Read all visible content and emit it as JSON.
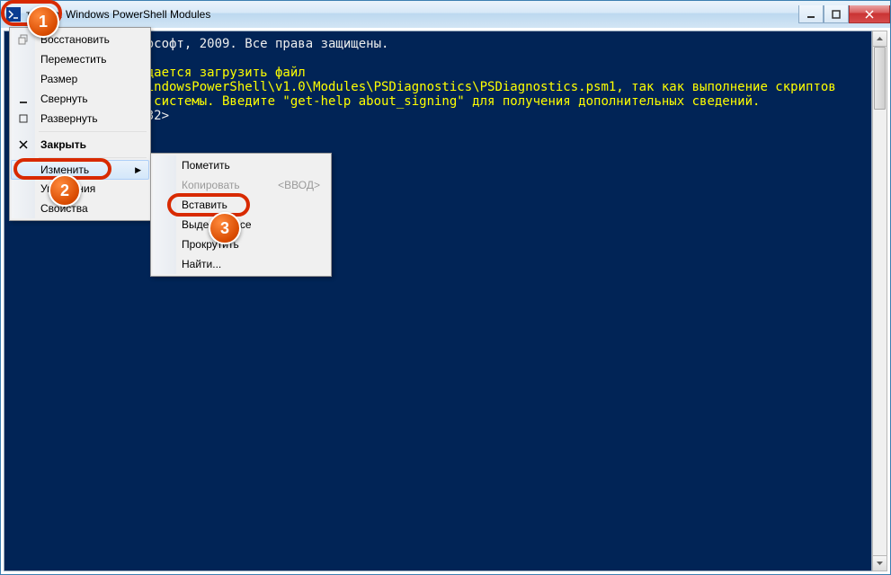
{
  "window": {
    "title": "тратор: Windows PowerShell Modules"
  },
  "console": {
    "line1_white": "ософт, 2009. Все права защищены.",
    "line2_y": "дается загрузить файл",
    "line3_y": "indowsPowerShell\\v1.0\\Modules\\PSDiagnostics\\PSDiagnostics.psm1, так как выполнение скриптов",
    "line4_y": " системы. Введите \"get-help about_signing\" для получения дополнительных сведений.",
    "line5_w": "32>"
  },
  "sysmenu": {
    "restore": "Восстановить",
    "move": "Переместить",
    "size": "Размер",
    "minimize": "Свернуть",
    "maximize": "Развернуть",
    "close": "Закрыть",
    "edit": "Изменить",
    "defaults": "Умолчания",
    "properties": "Свойства"
  },
  "submenu": {
    "mark": "Пометить",
    "copy": "Копировать",
    "copy_shortcut": "<ВВОД>",
    "paste": "Вставить",
    "select_all": "Выделить все",
    "scroll": "Прокрутить",
    "find": "Найти..."
  },
  "badges": {
    "b1": "1",
    "b2": "2",
    "b3": "3"
  }
}
